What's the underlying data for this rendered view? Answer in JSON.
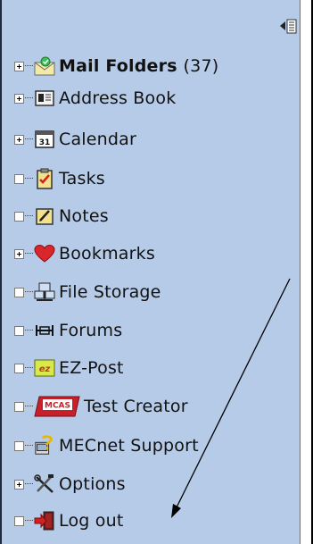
{
  "nav": {
    "items": [
      {
        "label": "Mail Folders",
        "count": "(37)",
        "icon": "mail-folders-icon",
        "expandable": true,
        "bold": true
      },
      {
        "label": "Address Book",
        "icon": "address-book-icon",
        "expandable": true
      },
      {
        "label": "Calendar",
        "icon": "calendar-icon",
        "icon_text": "31",
        "expandable": true
      },
      {
        "label": "Tasks",
        "icon": "tasks-icon",
        "expandable": false
      },
      {
        "label": "Notes",
        "icon": "notes-icon",
        "expandable": false
      },
      {
        "label": "Bookmarks",
        "icon": "heart-icon",
        "expandable": true
      },
      {
        "label": "File Storage",
        "icon": "file-storage-icon",
        "expandable": false
      },
      {
        "label": "Forums",
        "icon": "forums-icon",
        "expandable": false
      },
      {
        "label": "EZ-Post",
        "icon": "ez-post-icon",
        "icon_text": "ez",
        "expandable": false
      },
      {
        "label": "Test Creator",
        "icon": "mcas-icon",
        "icon_text": "MCAS",
        "expandable": false
      },
      {
        "label": "MECnet Support",
        "icon": "support-icon",
        "expandable": false
      },
      {
        "label": "Options",
        "icon": "tools-icon",
        "expandable": true
      },
      {
        "label": "Log out",
        "icon": "log-out-icon",
        "expandable": false
      }
    ]
  },
  "colors": {
    "panel_bg": "#b6cbe8",
    "heart": "#d8262b",
    "arrow": "#000000"
  }
}
